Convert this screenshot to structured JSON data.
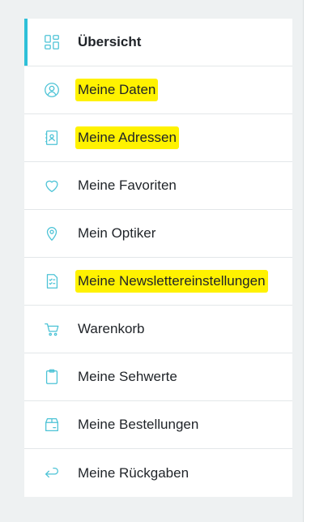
{
  "colors": {
    "accent": "#2ec0d8",
    "icon": "#4cc3d6",
    "highlight": "#fff200"
  },
  "menu": {
    "items": [
      {
        "label": "Übersicht",
        "icon": "dashboard-icon",
        "active": true,
        "highlighted": false
      },
      {
        "label": "Meine Daten",
        "icon": "user-circle-icon",
        "active": false,
        "highlighted": true
      },
      {
        "label": "Meine Adressen",
        "icon": "address-book-icon",
        "active": false,
        "highlighted": true
      },
      {
        "label": "Meine Favoriten",
        "icon": "heart-icon",
        "active": false,
        "highlighted": false
      },
      {
        "label": "Mein Optiker",
        "icon": "location-pin-icon",
        "active": false,
        "highlighted": false
      },
      {
        "label": "Meine Newslettereinstellungen",
        "icon": "checklist-icon",
        "active": false,
        "highlighted": true
      },
      {
        "label": "Warenkorb",
        "icon": "cart-icon",
        "active": false,
        "highlighted": false
      },
      {
        "label": "Meine Sehwerte",
        "icon": "clipboard-icon",
        "active": false,
        "highlighted": false
      },
      {
        "label": "Meine Bestellungen",
        "icon": "box-icon",
        "active": false,
        "highlighted": false
      },
      {
        "label": "Meine Rückgaben",
        "icon": "return-arrow-icon",
        "active": false,
        "highlighted": false
      }
    ]
  }
}
